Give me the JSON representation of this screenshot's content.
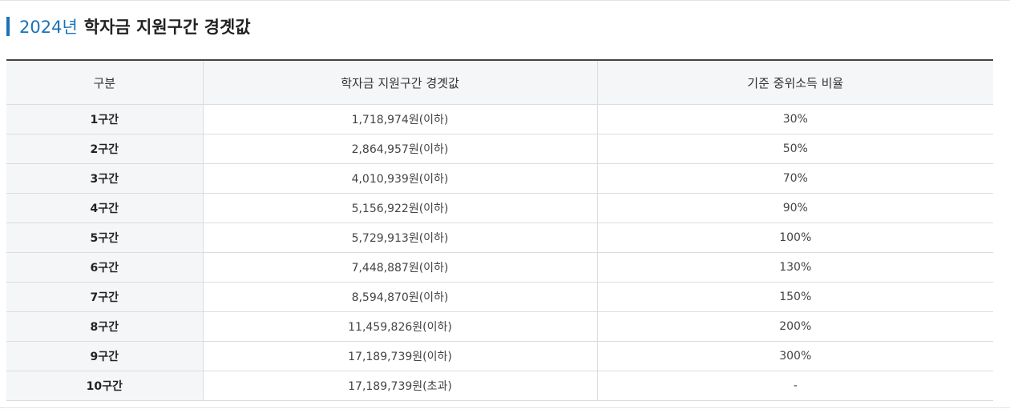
{
  "heading": {
    "year": "2024년",
    "title": "학자금 지원구간 경곗값"
  },
  "colors": {
    "accent": "#1a73b8",
    "header_bg": "#f5f6f8",
    "border": "#dcdcdc",
    "table_top_rule": "#444444"
  },
  "table": {
    "headers": [
      "구분",
      "학자금 지원구간 경곗값",
      "기준 중위소득 비율"
    ],
    "rows": [
      [
        "1구간",
        "1,718,974원(이하)",
        "30%"
      ],
      [
        "2구간",
        "2,864,957원(이하)",
        "50%"
      ],
      [
        "3구간",
        "4,010,939원(이하)",
        "70%"
      ],
      [
        "4구간",
        "5,156,922원(이하)",
        "90%"
      ],
      [
        "5구간",
        "5,729,913원(이하)",
        "100%"
      ],
      [
        "6구간",
        "7,448,887원(이하)",
        "130%"
      ],
      [
        "7구간",
        "8,594,870원(이하)",
        "150%"
      ],
      [
        "8구간",
        "11,459,826원(이하)",
        "200%"
      ],
      [
        "9구간",
        "17,189,739원(이하)",
        "300%"
      ],
      [
        "10구간",
        "17,189,739원(초과)",
        "-"
      ]
    ]
  }
}
